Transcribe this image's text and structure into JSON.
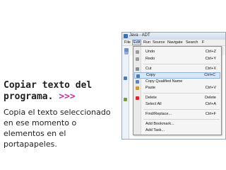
{
  "slide": {
    "title_line1": "Copiar texto del",
    "title_line2": "programa.",
    "title_arrows": ">>>",
    "body_lines": [
      "Copia el texto seleccionado",
      "en ese momento o",
      "elementos en el",
      "portapapeles."
    ]
  },
  "window": {
    "title": "Java - ADT"
  },
  "menubar": {
    "items": [
      "File",
      "Edit",
      "Run",
      "Source",
      "Navigate",
      "Search",
      "F"
    ],
    "active": "Edit"
  },
  "edit_menu": {
    "items": [
      {
        "label": "Undo",
        "shortcut": "Ctrl+Z",
        "icon": "undo-icon"
      },
      {
        "label": "Redo",
        "shortcut": "Ctrl+Y",
        "icon": "redo-icon"
      },
      {
        "label": "Cut",
        "shortcut": "Ctrl+X",
        "icon": "cut-icon"
      },
      {
        "label": "Copy",
        "shortcut": "Ctrl+C",
        "icon": "copy-icon"
      },
      {
        "label": "Copy Qualified Name",
        "shortcut": "",
        "icon": "copy-qualified-icon"
      },
      {
        "label": "Paste",
        "shortcut": "Ctrl+V",
        "icon": "paste-icon"
      },
      {
        "label": "Delete",
        "shortcut": "Delete",
        "icon": "delete-icon"
      },
      {
        "label": "Select All",
        "shortcut": "Ctrl+A",
        "icon": ""
      },
      {
        "label": "Find/Replace...",
        "shortcut": "Ctrl+F",
        "icon": ""
      },
      {
        "label": "Add Bookmark...",
        "shortcut": "",
        "icon": ""
      },
      {
        "label": "Add Task...",
        "shortcut": "",
        "icon": ""
      }
    ],
    "highlighted": "Copy"
  },
  "colors": {
    "accent_arrows": "#c0389a",
    "menu_highlight": "#d7e6f8",
    "delete_icon": "#d8262a",
    "copy_icon": "#3b7bd4"
  }
}
